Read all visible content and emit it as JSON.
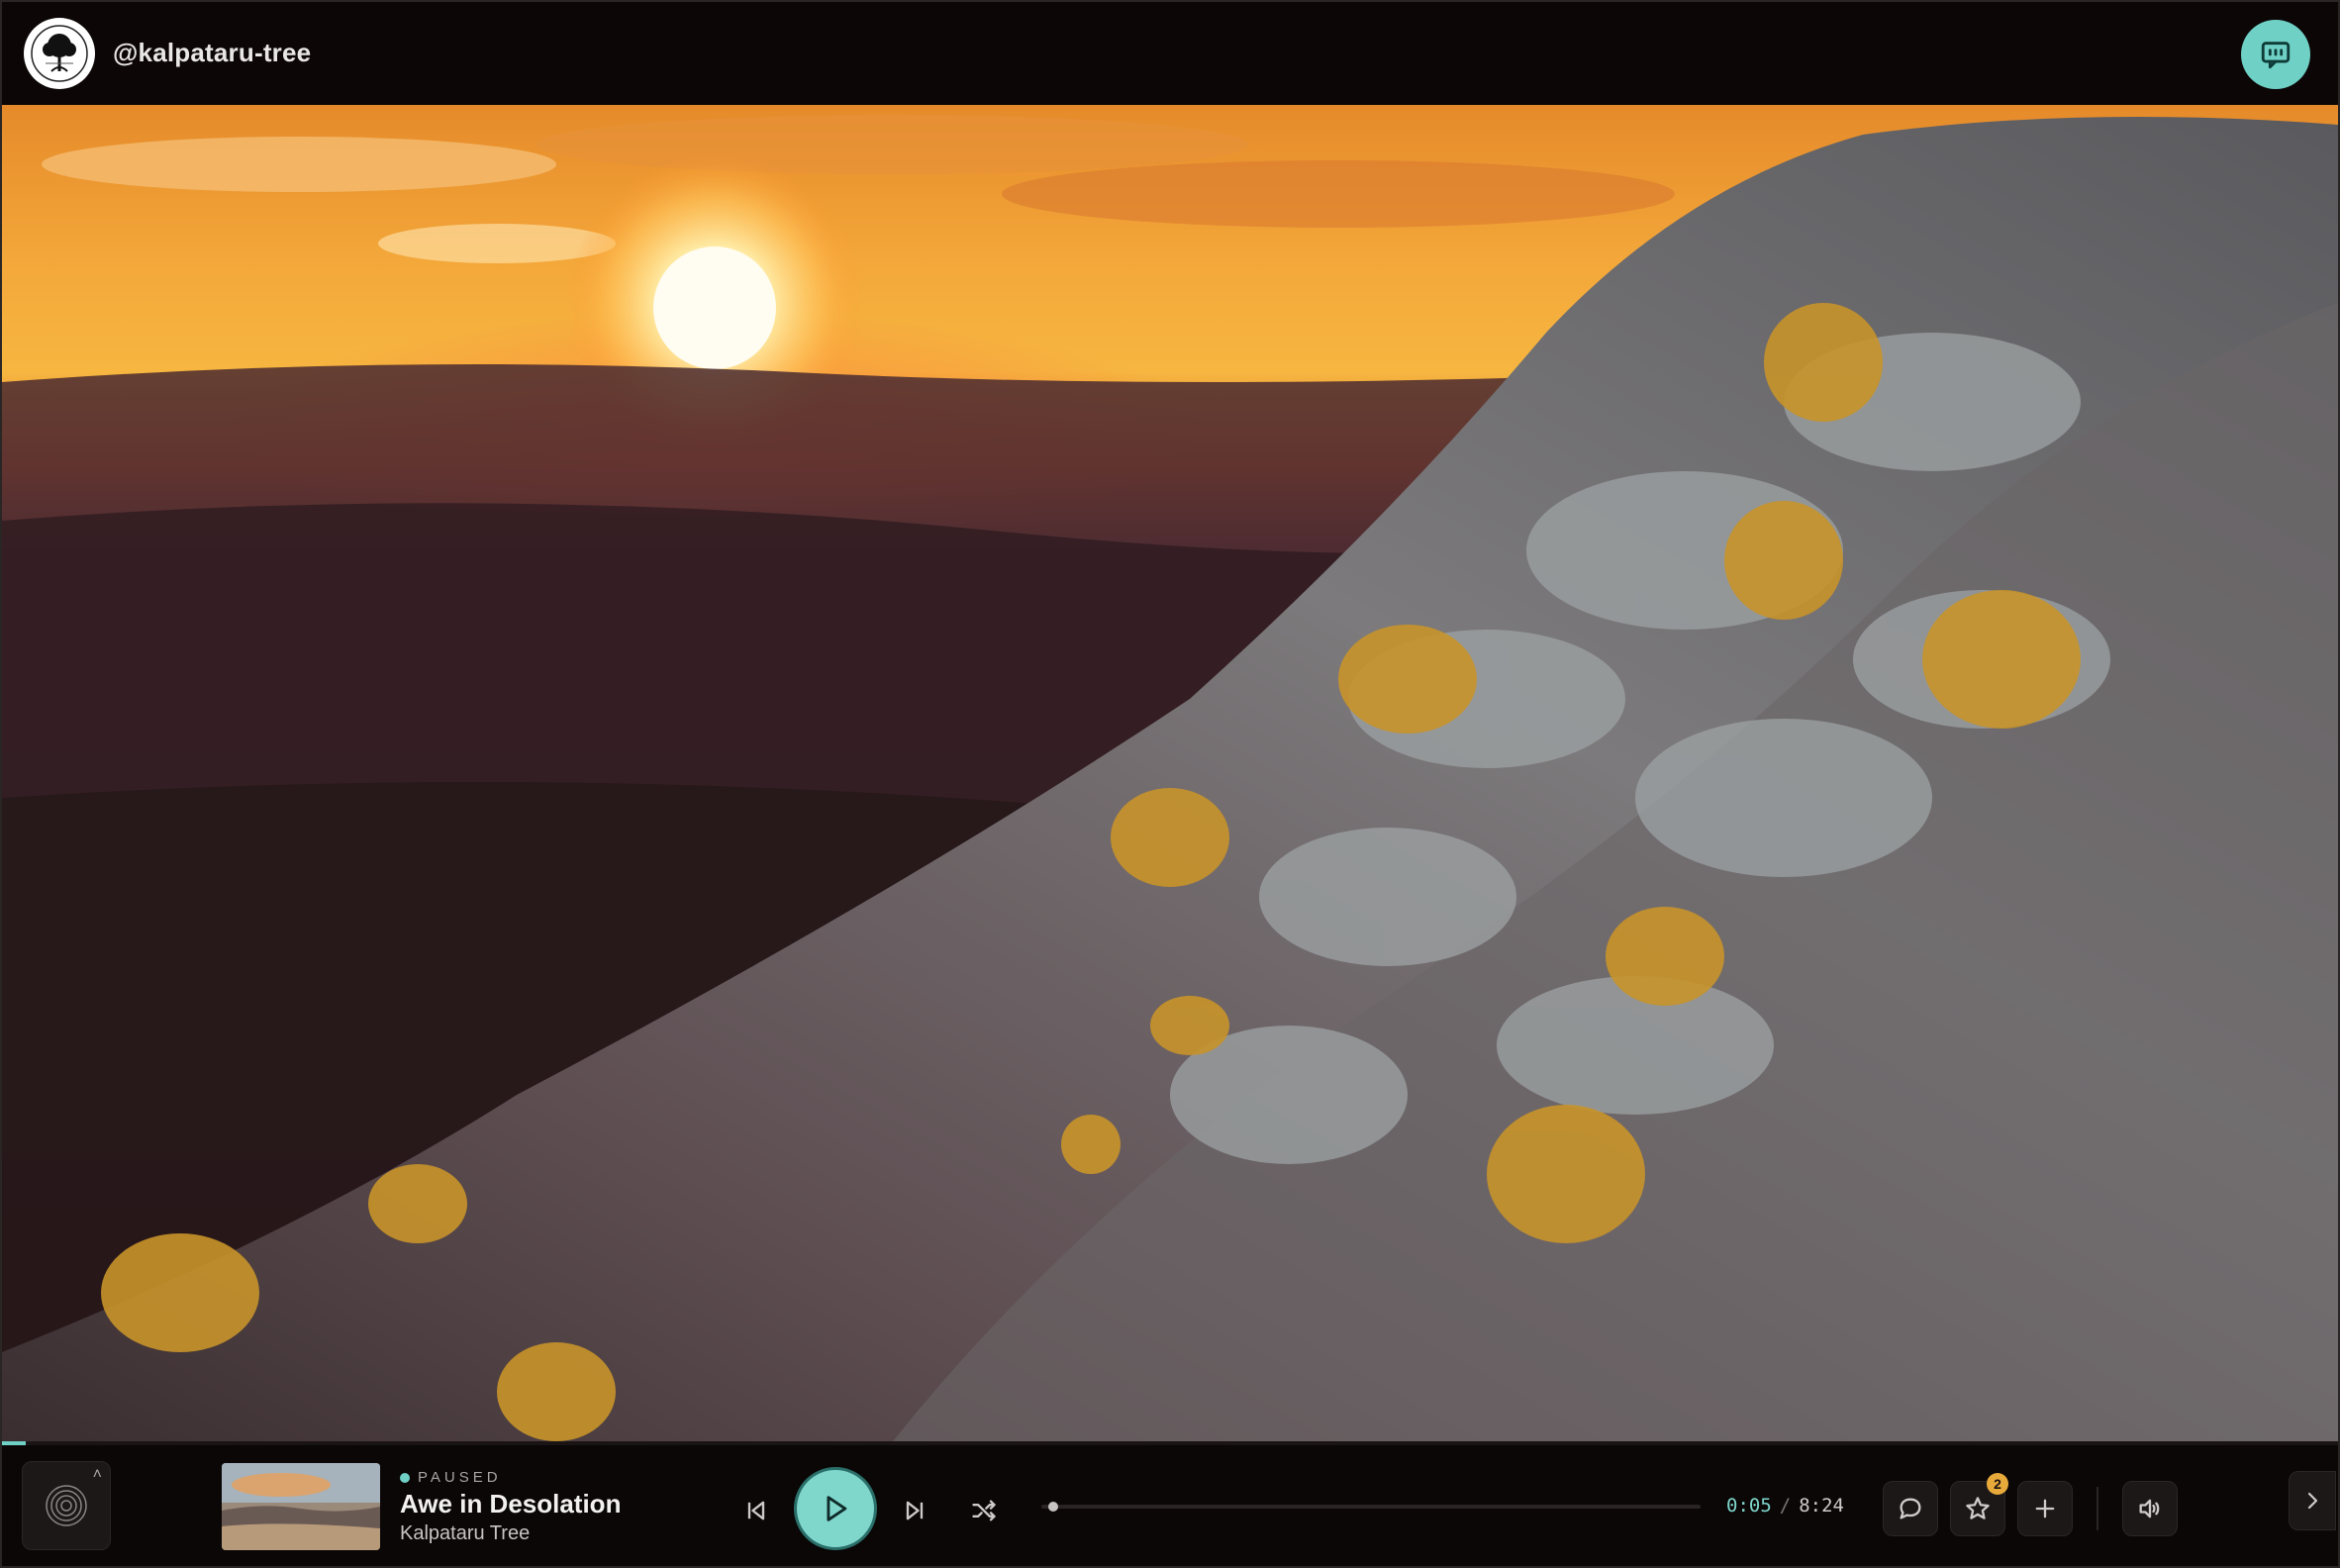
{
  "header": {
    "handle": "@kalpataru-tree",
    "avatar_icon": "kalpataru-tree-logo",
    "chat_icon": "message-icon"
  },
  "player": {
    "status": "PAUSED",
    "title": "Awe in Desolation",
    "artist": "Kalpataru Tree",
    "current_time": "0:05",
    "separator": "/",
    "duration": "8:24",
    "favorites_count": "2",
    "progress_fraction": 0.01
  },
  "colors": {
    "accent": "#6fd0c6",
    "badge": "#e6a93a",
    "background": "#0b0707"
  },
  "icons": {
    "visualizer": "visualizer-icon",
    "previous": "skip-previous-icon",
    "play": "play-icon",
    "next": "skip-next-icon",
    "shuffle": "shuffle-icon",
    "comment": "comment-icon",
    "favorite": "star-icon",
    "add": "plus-icon",
    "volume": "volume-icon",
    "expand": "chevron-right-icon"
  }
}
